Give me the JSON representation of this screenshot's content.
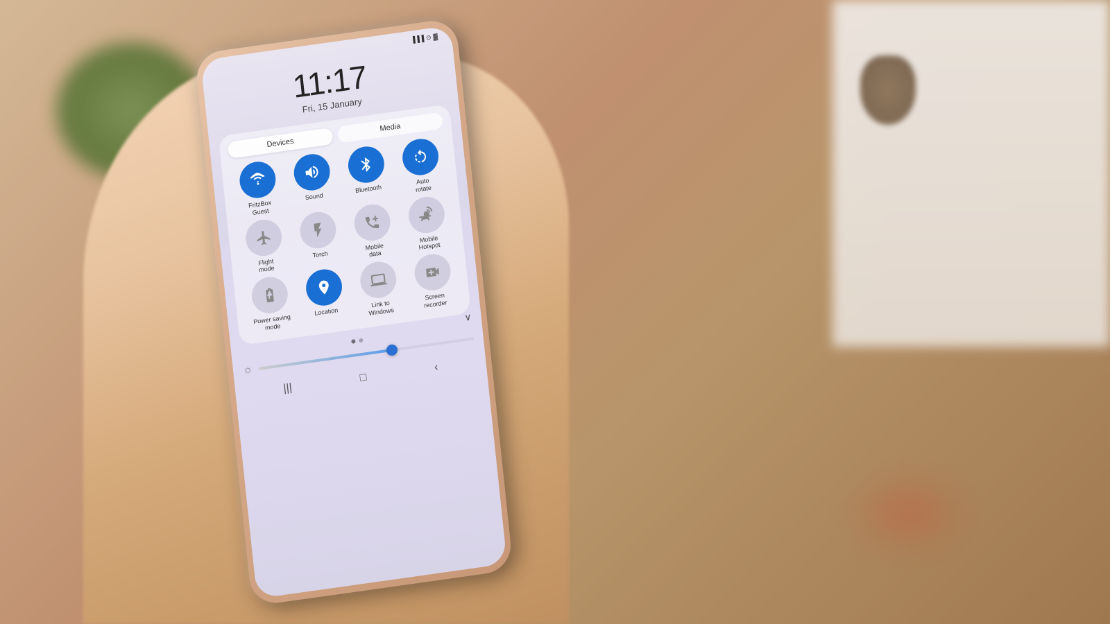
{
  "scene": {
    "clock": {
      "time": "11:17",
      "date": "Fri, 15 January"
    },
    "tabs": [
      {
        "label": "Devices",
        "active": true
      },
      {
        "label": "Media",
        "active": false
      }
    ],
    "toggles": [
      {
        "id": "wifi",
        "label": "FritzBox\nGuest",
        "active": true,
        "icon": "wifi"
      },
      {
        "id": "sound",
        "label": "Sound",
        "active": true,
        "icon": "sound"
      },
      {
        "id": "bluetooth",
        "label": "Bluetooth",
        "active": true,
        "icon": "bluetooth"
      },
      {
        "id": "autorotate",
        "label": "Auto\nrotate",
        "active": true,
        "icon": "autorotate"
      },
      {
        "id": "flightmode",
        "label": "Flight\nmode",
        "active": false,
        "icon": "plane"
      },
      {
        "id": "torch",
        "label": "Torch",
        "active": false,
        "icon": "torch"
      },
      {
        "id": "mobiledata",
        "label": "Mobile\ndata",
        "active": false,
        "icon": "mobiledata"
      },
      {
        "id": "mobilehotspot",
        "label": "Mobile\nHotspot",
        "active": false,
        "icon": "hotspot"
      },
      {
        "id": "powersaving",
        "label": "Power saving\nmode",
        "active": false,
        "icon": "battery"
      },
      {
        "id": "location",
        "label": "Location",
        "active": true,
        "icon": "location"
      },
      {
        "id": "linktowwindows",
        "label": "Link to\nWindows",
        "active": false,
        "icon": "link"
      },
      {
        "id": "screenrecorder",
        "label": "Screen\nrecorder",
        "active": false,
        "icon": "record"
      }
    ],
    "brightness": {
      "value": 62
    },
    "nav": {
      "back_label": "‹",
      "home_label": "□",
      "recent_label": "|||"
    }
  }
}
